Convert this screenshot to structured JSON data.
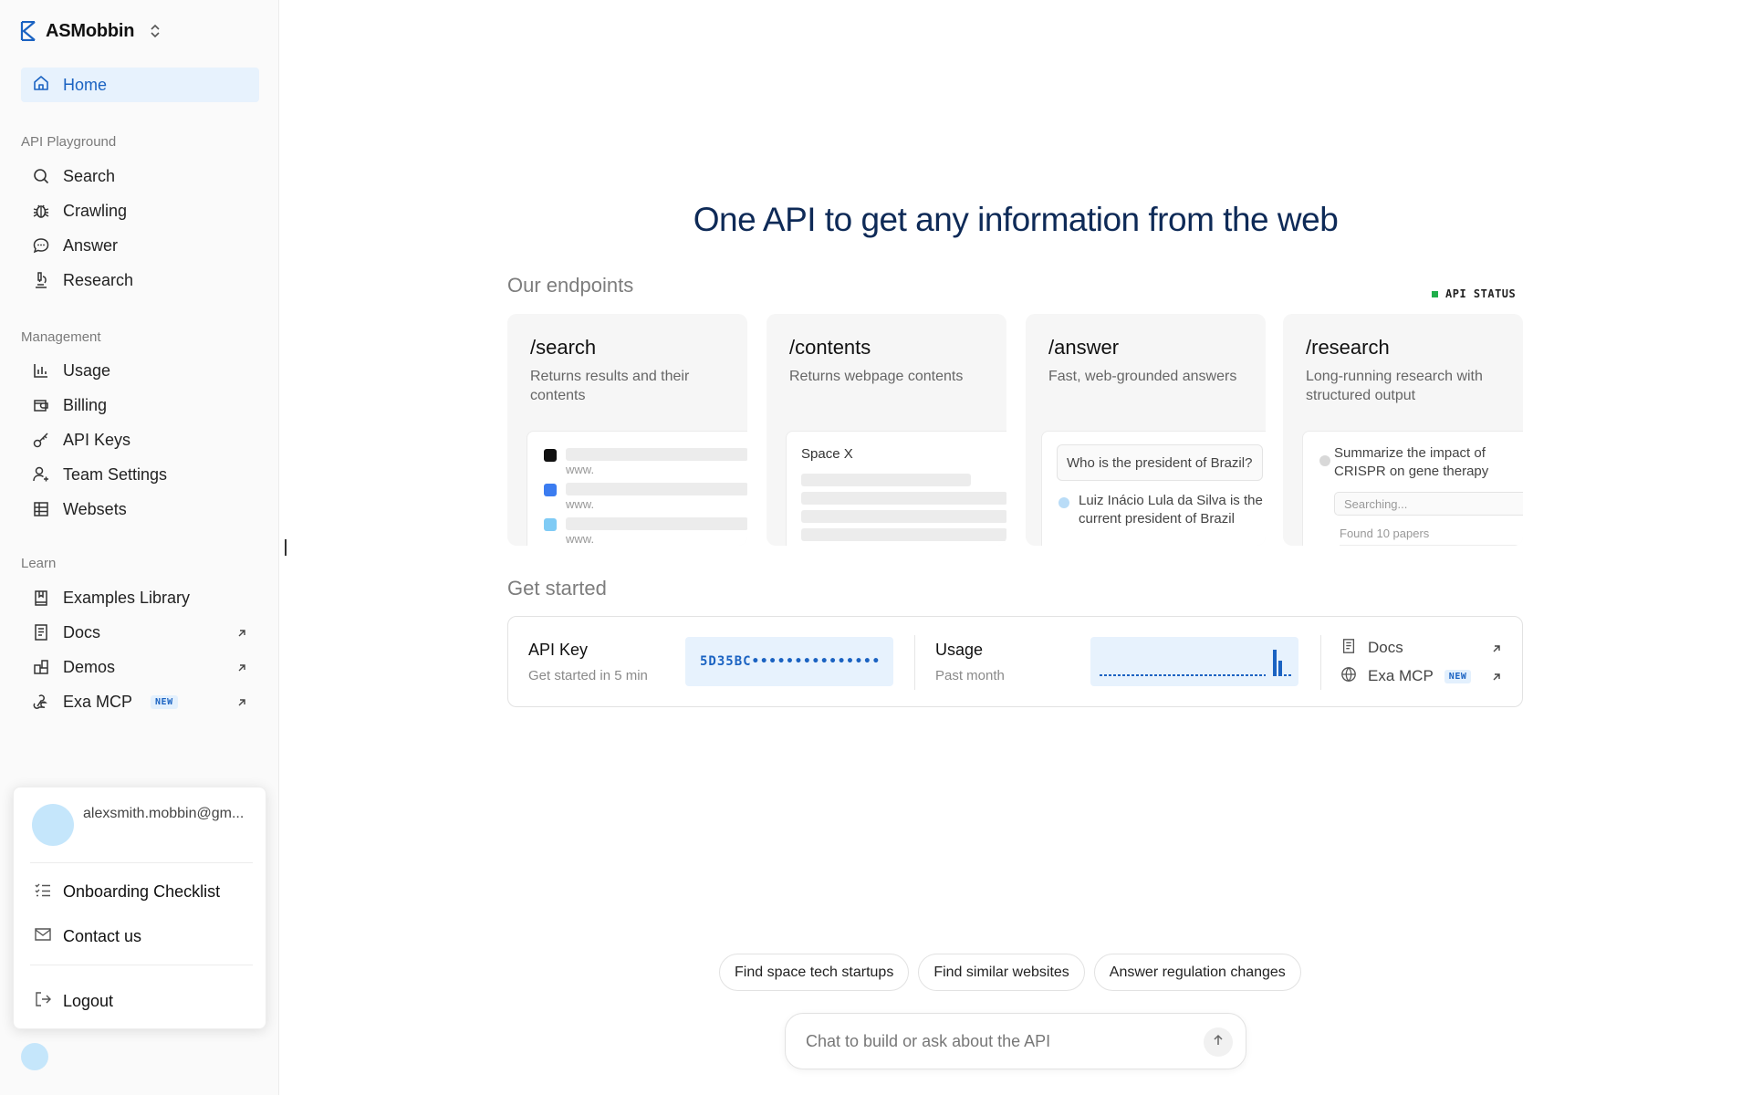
{
  "sidebar": {
    "brand": "ASMobbin",
    "home": "Home",
    "sections": {
      "playground": "API Playground",
      "management": "Management",
      "learn": "Learn"
    },
    "playground_items": [
      "Search",
      "Crawling",
      "Answer",
      "Research"
    ],
    "management_items": [
      "Usage",
      "Billing",
      "API Keys",
      "Team Settings",
      "Websets"
    ],
    "learn_items": [
      "Examples Library",
      "Docs",
      "Demos",
      "Exa MCP"
    ],
    "new_badge": "NEW"
  },
  "account_menu": {
    "email": "alexsmith.mobbin@gm...",
    "onboarding": "Onboarding Checklist",
    "contact": "Contact us",
    "logout": "Logout"
  },
  "main": {
    "title": "One API to get any information from the web",
    "endpoints_heading": "Our endpoints",
    "api_status": "API STATUS",
    "endpoints": [
      {
        "name": "/search",
        "desc": "Returns results and their contents"
      },
      {
        "name": "/contents",
        "desc": "Returns webpage contents"
      },
      {
        "name": "/answer",
        "desc": "Fast, web-grounded answers"
      },
      {
        "name": "/research",
        "desc": "Long-running research with structured output"
      }
    ],
    "search_preview": {
      "www": "www."
    },
    "contents_preview": {
      "title": "Space X"
    },
    "answer_preview": {
      "question": "Who is the president of Brazil?",
      "answer": "Luiz Inácio Lula da Silva is the current president of Brazil"
    },
    "research_preview": {
      "task": "Summarize the impact of CRISPR on gene therapy",
      "status": "Searching...",
      "found": "Found 10 papers"
    },
    "get_started_heading": "Get started",
    "api_key": {
      "label": "API Key",
      "sub": "Get started in 5 min",
      "value": "5D35BC•••••••••••••••"
    },
    "usage": {
      "label": "Usage",
      "sub": "Past month"
    },
    "links": {
      "docs": "Docs",
      "mcp": "Exa MCP",
      "badge": "NEW"
    },
    "chips": [
      "Find space tech startups",
      "Find similar websites",
      "Answer regulation changes"
    ],
    "chat_placeholder": "Chat to build or ask about the API"
  },
  "colors": {
    "accent": "#1b63c2",
    "accent_bg": "#e7f2fd",
    "status_green": "#1fae4b"
  }
}
